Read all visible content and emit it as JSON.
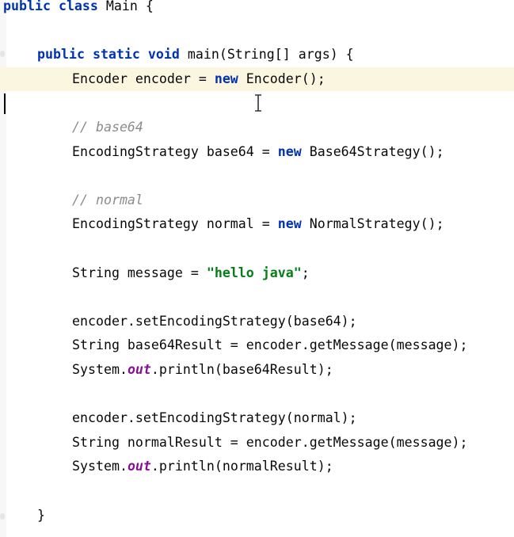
{
  "editor": {
    "language": "Java",
    "current_line_index": 3,
    "lines": [
      {
        "indent": 0,
        "tokens": [
          {
            "t": "kw",
            "v": "public"
          },
          {
            "t": "plain",
            "v": " "
          },
          {
            "t": "kw",
            "v": "class"
          },
          {
            "t": "plain",
            "v": " Main {"
          }
        ]
      },
      {
        "indent": 0,
        "tokens": []
      },
      {
        "indent": 1,
        "tokens": [
          {
            "t": "kw",
            "v": "public"
          },
          {
            "t": "plain",
            "v": " "
          },
          {
            "t": "kw",
            "v": "static"
          },
          {
            "t": "plain",
            "v": " "
          },
          {
            "t": "kw",
            "v": "void"
          },
          {
            "t": "plain",
            "v": " main(String[] args) {"
          }
        ]
      },
      {
        "indent": 2,
        "tokens": [
          {
            "t": "plain",
            "v": "Encoder encoder = "
          },
          {
            "t": "kw",
            "v": "new"
          },
          {
            "t": "plain",
            "v": " Encoder();"
          }
        ]
      },
      {
        "indent": 0,
        "tokens": []
      },
      {
        "indent": 2,
        "tokens": [
          {
            "t": "cmt",
            "v": "// base64"
          }
        ]
      },
      {
        "indent": 2,
        "tokens": [
          {
            "t": "plain",
            "v": "EncodingStrategy base64 = "
          },
          {
            "t": "kw",
            "v": "new"
          },
          {
            "t": "plain",
            "v": " Base64Strategy();"
          }
        ]
      },
      {
        "indent": 0,
        "tokens": []
      },
      {
        "indent": 2,
        "tokens": [
          {
            "t": "cmt",
            "v": "// normal"
          }
        ]
      },
      {
        "indent": 2,
        "tokens": [
          {
            "t": "plain",
            "v": "EncodingStrategy normal = "
          },
          {
            "t": "kw",
            "v": "new"
          },
          {
            "t": "plain",
            "v": " NormalStrategy();"
          }
        ]
      },
      {
        "indent": 0,
        "tokens": []
      },
      {
        "indent": 2,
        "tokens": [
          {
            "t": "plain",
            "v": "String message = "
          },
          {
            "t": "str",
            "v": "\"hello java\""
          },
          {
            "t": "plain",
            "v": ";"
          }
        ]
      },
      {
        "indent": 0,
        "tokens": []
      },
      {
        "indent": 2,
        "tokens": [
          {
            "t": "plain",
            "v": "encoder.setEncodingStrategy(base64);"
          }
        ]
      },
      {
        "indent": 2,
        "tokens": [
          {
            "t": "plain",
            "v": "String base64Result = encoder.getMessage(message);"
          }
        ]
      },
      {
        "indent": 2,
        "tokens": [
          {
            "t": "plain",
            "v": "System."
          },
          {
            "t": "fld",
            "v": "out"
          },
          {
            "t": "plain",
            "v": ".println(base64Result);"
          }
        ]
      },
      {
        "indent": 0,
        "tokens": []
      },
      {
        "indent": 2,
        "tokens": [
          {
            "t": "plain",
            "v": "encoder.setEncodingStrategy(normal);"
          }
        ]
      },
      {
        "indent": 2,
        "tokens": [
          {
            "t": "plain",
            "v": "String normalResult = encoder.getMessage(message);"
          }
        ]
      },
      {
        "indent": 2,
        "tokens": [
          {
            "t": "plain",
            "v": "System."
          },
          {
            "t": "fld",
            "v": "out"
          },
          {
            "t": "plain",
            "v": ".println(normalResult);"
          }
        ]
      },
      {
        "indent": 0,
        "tokens": []
      },
      {
        "indent": 1,
        "tokens": [
          {
            "t": "plain",
            "v": "}"
          }
        ]
      }
    ],
    "colors": {
      "keyword": "#0033b3",
      "comment": "#8c8c8c",
      "string": "#067d17",
      "static_field": "#871094",
      "text": "#080808",
      "current_line_bg": "#fbf6e0"
    }
  }
}
